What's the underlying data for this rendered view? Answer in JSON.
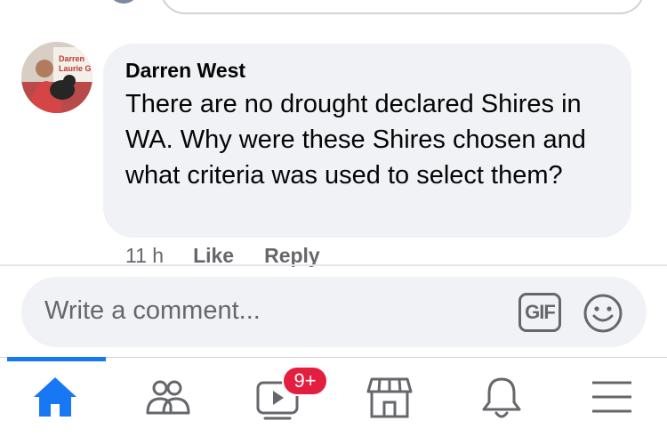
{
  "comment": {
    "author": "Darren West",
    "text": "There are no drought declared Shires in WA. Why were these Shires chosen and what criteria was used to select them?",
    "time": "11 h",
    "like_label": "Like",
    "reply_label": "Reply",
    "avatar_sign_text": "Darren Laurie G"
  },
  "composer": {
    "placeholder": "Write a comment...",
    "gif_label": "GIF",
    "emoji_icon": "smiley-icon"
  },
  "nav": {
    "items": [
      {
        "name": "home",
        "icon": "home-icon",
        "active": true
      },
      {
        "name": "friends",
        "icon": "friends-icon"
      },
      {
        "name": "watch",
        "icon": "video-icon",
        "badge": "9+"
      },
      {
        "name": "marketplace",
        "icon": "marketplace-icon"
      },
      {
        "name": "notifications",
        "icon": "bell-icon"
      },
      {
        "name": "menu",
        "icon": "hamburger-icon"
      }
    ]
  },
  "colors": {
    "accent": "#1877f2",
    "badge": "#e41e3f",
    "icon_gray": "#65676b",
    "bubble": "#f0f2f5"
  }
}
